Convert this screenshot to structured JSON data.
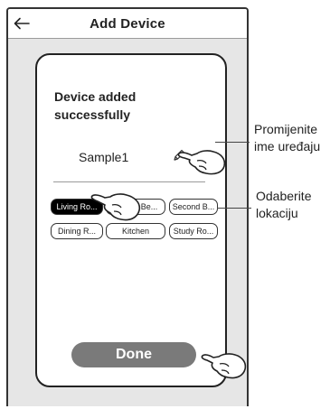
{
  "header": {
    "title": "Add Device"
  },
  "card": {
    "success_line1": "Device added",
    "success_line2": "successfully",
    "device_name": "Sample1"
  },
  "rooms": [
    {
      "label": "Living Ro...",
      "selected": true
    },
    {
      "label": "Master Be...",
      "selected": false
    },
    {
      "label": "Second B...",
      "selected": false
    },
    {
      "label": "Dining R...",
      "selected": false
    },
    {
      "label": "Kitchen",
      "selected": false
    },
    {
      "label": "Study Ro...",
      "selected": false
    }
  ],
  "done_button": {
    "label": "Done"
  },
  "annotations": {
    "rename_line1": "Promijenite",
    "rename_line2": "ime uređaju",
    "location_line1": "Odaberite",
    "location_line2": "lokaciju"
  },
  "icons": {
    "back": "arrow-left-icon",
    "edit": "pencil-icon",
    "hand": "pointing-hand-icon"
  },
  "colors": {
    "selected_room_bg": "#000000",
    "done_button_bg": "#7a7a7a",
    "screen_bg": "#e6e6e6"
  }
}
